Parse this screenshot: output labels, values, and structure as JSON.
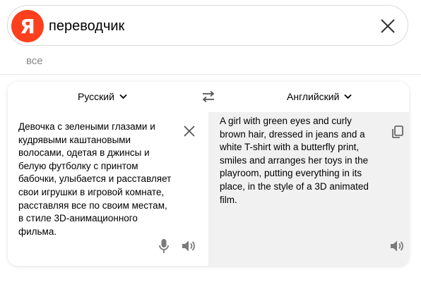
{
  "search": {
    "logo_letter": "Я",
    "query": "переводчик",
    "clear_icon": "close-icon"
  },
  "tabs": {
    "all_label": "все"
  },
  "translator": {
    "source_lang": "Русский",
    "target_lang": "Английский",
    "source_text": "Девочка с зелеными глазами и\nкудрявыми каштановыми\nволосами, одетая в джинсы и\nбелую футболку с принтом\nбабочки, улыбается и расставляет\nсвои игрушки в игровой комнате,\nрасставляя все по своим местам,\nв стиле 3D-анимационного\nфильма.",
    "target_text": "A girl with green eyes and curly\nbrown hair, dressed in jeans and a\nwhite T-shirt with a butterfly print,\nsmiles and arranges her toys in the\nplayroom, putting everything in its\nplace, in the style of a 3D animated\nfilm.",
    "icons": {
      "swap": "swap-arrows-icon",
      "clear": "close-icon",
      "copy": "copy-icon",
      "mic": "microphone-icon",
      "speaker": "speaker-icon"
    }
  },
  "colors": {
    "brand": "#fc3f1d",
    "target_pane_bg": "#f1f1f1",
    "icon_gray": "#7a7a7a"
  }
}
